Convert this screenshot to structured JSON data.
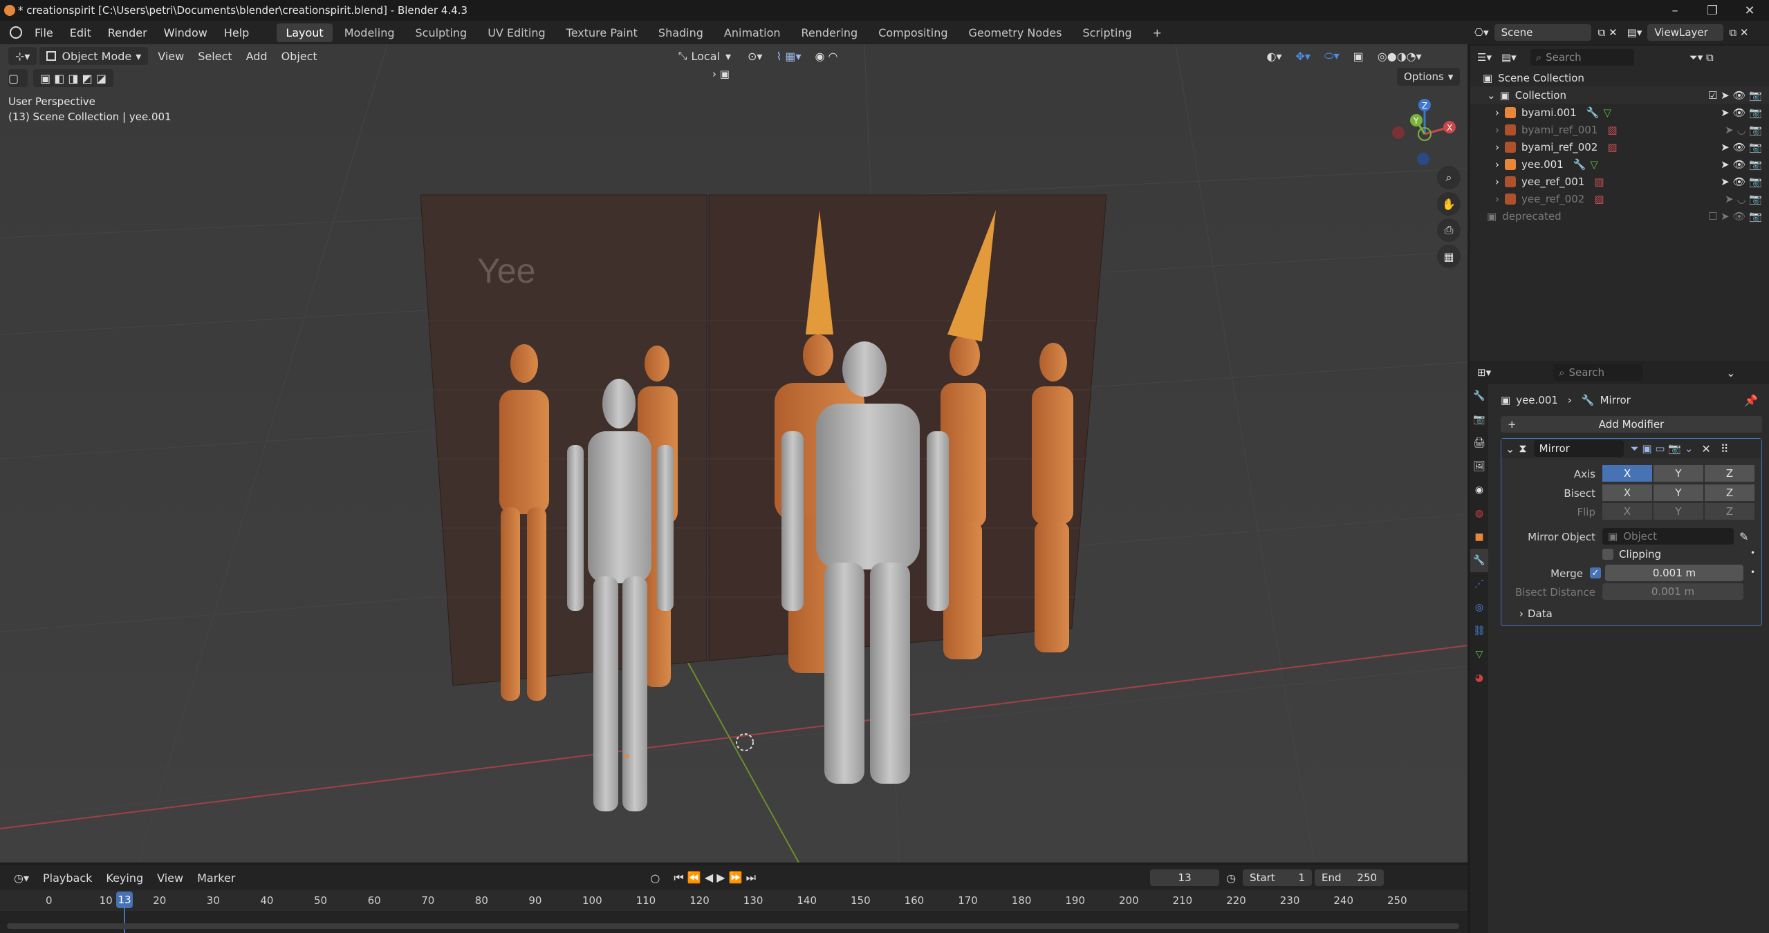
{
  "window": {
    "title": "* creationspirit [C:\\Users\\petri\\Documents\\blender\\creationspirit.blend] - Blender 4.4.3",
    "min": "–",
    "max": "❐",
    "close": "✕"
  },
  "menu": [
    "File",
    "Edit",
    "Render",
    "Window",
    "Help"
  ],
  "workspaces": [
    "Layout",
    "Modeling",
    "Sculpting",
    "UV Editing",
    "Texture Paint",
    "Shading",
    "Animation",
    "Rendering",
    "Compositing",
    "Geometry Nodes",
    "Scripting",
    "+"
  ],
  "viewport": {
    "mode": "Object Mode",
    "menus": [
      "View",
      "Select",
      "Add",
      "Object"
    ],
    "orientation": "Local",
    "options": "Options",
    "perspective": "User Perspective",
    "context": "(13) Scene Collection | yee.001",
    "ref_text": "Yee",
    "gizmo": {
      "z": "Z",
      "y": "Y",
      "x": "X"
    }
  },
  "timeline": {
    "menus": [
      "Playback",
      "Keying",
      "View",
      "Marker"
    ],
    "current_frame": "13",
    "start_label": "Start",
    "start": "1",
    "end_label": "End",
    "end": "250",
    "ticks": [
      "0",
      "10",
      "20",
      "30",
      "40",
      "50",
      "60",
      "70",
      "80",
      "90",
      "100",
      "110",
      "120",
      "130",
      "140",
      "150",
      "160",
      "170",
      "180",
      "190",
      "200",
      "210",
      "220",
      "230",
      "240",
      "250"
    ]
  },
  "topright": {
    "scene": "Scene",
    "viewlayer": "ViewLayer"
  },
  "outliner": {
    "search_placeholder": "Search",
    "root": "Scene Collection",
    "collection": "Collection",
    "items": [
      {
        "name": "byami.001",
        "dim": false
      },
      {
        "name": "byami_ref_001",
        "dim": true
      },
      {
        "name": "byami_ref_002",
        "dim": false
      },
      {
        "name": "yee.001",
        "dim": false
      },
      {
        "name": "yee_ref_001",
        "dim": false
      },
      {
        "name": "yee_ref_002",
        "dim": true
      }
    ],
    "deprecated": "deprecated"
  },
  "properties": {
    "search_placeholder": "Search",
    "breadcrumb_object": "yee.001",
    "breadcrumb_modifier": "Mirror",
    "add_modifier": "Add Modifier",
    "modifier_name": "Mirror",
    "axis_label": "Axis",
    "bisect_label": "Bisect",
    "flip_label": "Flip",
    "axes": [
      "X",
      "Y",
      "Z"
    ],
    "mirror_object_label": "Mirror Object",
    "mirror_object_placeholder": "Object",
    "clipping": "Clipping",
    "merge_label": "Merge",
    "merge_value": "0.001 m",
    "bisect_distance_label": "Bisect Distance",
    "bisect_distance_value": "0.001 m",
    "data_panel": "Data"
  },
  "colors": {
    "accent": "#4772b3",
    "x_axis": "#c8484c",
    "y_axis": "#7ab33b",
    "z_axis": "#3f77cf",
    "orange": "#e8873a"
  }
}
